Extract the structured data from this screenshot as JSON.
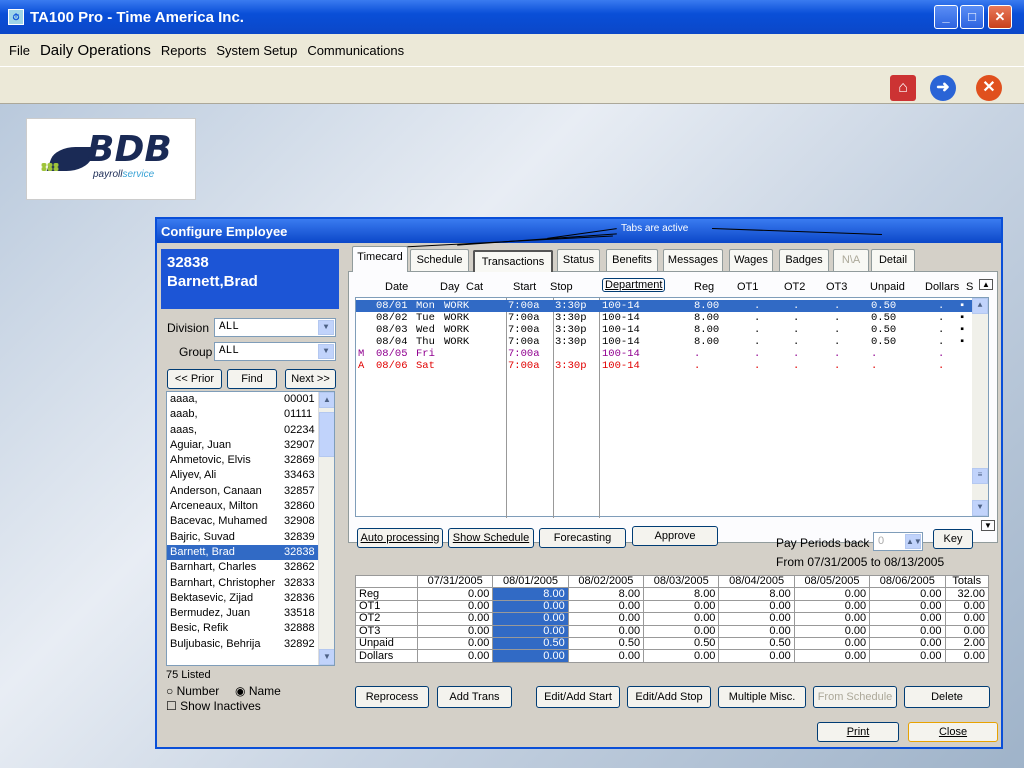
{
  "app": {
    "title": "TA100 Pro - Time America Inc.",
    "icon": "app-icon"
  },
  "menu": [
    "File",
    "Daily Operations",
    "Reports",
    "System Setup",
    "Communications"
  ],
  "toolbar_icons": [
    "home-icon",
    "forward-arrow-icon",
    "close-icon"
  ],
  "logo": {
    "brand": "BDB",
    "tagline_a": "payroll",
    "tagline_b": "service"
  },
  "dialog": {
    "title": "Configure Employee"
  },
  "employee": {
    "id": "32838",
    "name": "Barnett,Brad"
  },
  "filters": {
    "division_label": "Division",
    "division_value": "ALL",
    "group_label": "Group",
    "group_value": "ALL"
  },
  "nav": {
    "prior": "<< Prior",
    "find": "Find",
    "next": "Next >>"
  },
  "employees": [
    {
      "name": "aaaa,",
      "num": "00001"
    },
    {
      "name": "aaab,",
      "num": "01111"
    },
    {
      "name": "aaas,",
      "num": "02234"
    },
    {
      "name": "Aguiar, Juan",
      "num": "32907"
    },
    {
      "name": "Ahmetovic, Elvis",
      "num": "32869"
    },
    {
      "name": "Aliyev, Ali",
      "num": "33463"
    },
    {
      "name": "Anderson, Canaan",
      "num": "32857"
    },
    {
      "name": "Arceneaux, Milton",
      "num": "32860"
    },
    {
      "name": "Bacevac, Muhamed",
      "num": "32908"
    },
    {
      "name": "Bajric, Suvad",
      "num": "32839"
    },
    {
      "name": "Barnett, Brad",
      "num": "32838",
      "selected": true
    },
    {
      "name": "Barnhart, Charles",
      "num": "32862"
    },
    {
      "name": "Barnhart, Christopher",
      "num": "32833"
    },
    {
      "name": "Bektasevic, Zijad",
      "num": "32836"
    },
    {
      "name": "Bermudez, Juan",
      "num": "33518"
    },
    {
      "name": "Besic, Refik",
      "num": "32888"
    },
    {
      "name": "Buljubasic, Behrija",
      "num": "32892"
    }
  ],
  "listed": "75 Listed",
  "sort": {
    "number": "Number",
    "name": "Name",
    "selected": "Name"
  },
  "show_inactives": "Show Inactives",
  "annotation": "Tabs are active",
  "tabs": [
    "Timecard",
    "Schedule",
    "Transactions",
    "Status",
    "Benefits",
    "Messages",
    "Wages",
    "Badges",
    "N\\A",
    "Detail"
  ],
  "active_tab": "Timecard",
  "columns": [
    "Date",
    "Day",
    "Cat",
    "Start",
    "Stop",
    "Department",
    "Reg",
    "OT1",
    "OT2",
    "OT3",
    "Unpaid",
    "Dollars",
    "S"
  ],
  "rows": [
    {
      "flag": "",
      "date": "08/01",
      "day": "Mon",
      "cat": "WORK",
      "start": "7:00a",
      "stop": "3:30p",
      "dept": "100-14",
      "reg": "8.00",
      "ot1": ".",
      "ot2": ".",
      "ot3": ".",
      "unpaid": "0.50",
      "dollars": ".",
      "s": "▪",
      "style": "sel"
    },
    {
      "flag": "",
      "date": "08/02",
      "day": "Tue",
      "cat": "WORK",
      "start": "7:00a",
      "stop": "3:30p",
      "dept": "100-14",
      "reg": "8.00",
      "ot1": ".",
      "ot2": ".",
      "ot3": ".",
      "unpaid": "0.50",
      "dollars": ".",
      "s": "▪",
      "style": ""
    },
    {
      "flag": "",
      "date": "08/03",
      "day": "Wed",
      "cat": "WORK",
      "start": "7:00a",
      "stop": "3:30p",
      "dept": "100-14",
      "reg": "8.00",
      "ot1": ".",
      "ot2": ".",
      "ot3": ".",
      "unpaid": "0.50",
      "dollars": ".",
      "s": "▪",
      "style": ""
    },
    {
      "flag": "",
      "date": "08/04",
      "day": "Thu",
      "cat": "WORK",
      "start": "7:00a",
      "stop": "3:30p",
      "dept": "100-14",
      "reg": "8.00",
      "ot1": ".",
      "ot2": ".",
      "ot3": ".",
      "unpaid": "0.50",
      "dollars": ".",
      "s": "▪",
      "style": ""
    },
    {
      "flag": "M",
      "date": "08/05",
      "day": "Fri",
      "cat": "",
      "start": "7:00a",
      "stop": "",
      "dept": "100-14",
      "reg": ".",
      "ot1": ".",
      "ot2": ".",
      "ot3": ".",
      "unpaid": ".",
      "dollars": ".",
      "s": "",
      "style": "mag"
    },
    {
      "flag": "A",
      "date": "08/06",
      "day": "Sat",
      "cat": "",
      "start": "7:00a",
      "stop": "3:30p",
      "dept": "100-14",
      "reg": ".",
      "ot1": ".",
      "ot2": ".",
      "ot3": ".",
      "unpaid": ".",
      "dollars": ".",
      "s": "",
      "style": "red"
    }
  ],
  "actions": {
    "auto": "Auto processing",
    "show_schedule": "Show Schedule",
    "forecasting": "Forecasting",
    "approve": "Approve"
  },
  "pay_periods": {
    "label": "Pay Periods back",
    "value": "0",
    "key": "Key",
    "range": "From 07/31/2005 to 08/13/2005"
  },
  "totals": {
    "dates": [
      "07/31/2005",
      "08/01/2005",
      "08/02/2005",
      "08/03/2005",
      "08/04/2005",
      "08/05/2005",
      "08/06/2005",
      "Totals"
    ],
    "rows": [
      {
        "label": "Reg",
        "vals": [
          "0.00",
          "8.00",
          "8.00",
          "8.00",
          "8.00",
          "0.00",
          "0.00",
          "32.00"
        ]
      },
      {
        "label": "OT1",
        "vals": [
          "0.00",
          "0.00",
          "0.00",
          "0.00",
          "0.00",
          "0.00",
          "0.00",
          "0.00"
        ]
      },
      {
        "label": "OT2",
        "vals": [
          "0.00",
          "0.00",
          "0.00",
          "0.00",
          "0.00",
          "0.00",
          "0.00",
          "0.00"
        ]
      },
      {
        "label": "OT3",
        "vals": [
          "0.00",
          "0.00",
          "0.00",
          "0.00",
          "0.00",
          "0.00",
          "0.00",
          "0.00"
        ]
      },
      {
        "label": "Unpaid",
        "vals": [
          "0.00",
          "0.50",
          "0.50",
          "0.50",
          "0.50",
          "0.00",
          "0.00",
          "2.00"
        ]
      },
      {
        "label": "Dollars",
        "vals": [
          "0.00",
          "0.00",
          "0.00",
          "0.00",
          "0.00",
          "0.00",
          "0.00",
          "0.00"
        ]
      }
    ]
  },
  "bottom_buttons": [
    "Reprocess",
    "Add Trans",
    "Edit/Add Start",
    "Edit/Add Stop",
    "Multiple Misc.",
    "From Schedule",
    "Delete"
  ],
  "footer": {
    "print": "Print",
    "close": "Close"
  }
}
